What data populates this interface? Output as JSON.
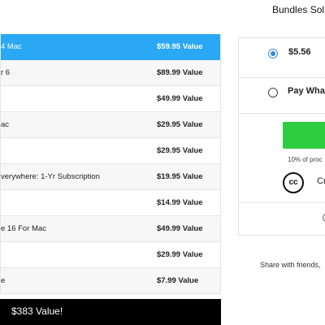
{
  "status_title": "Bundles Sol",
  "items": [
    {
      "name": "4 Mac",
      "value": "$59.95 Value",
      "highlighted": true
    },
    {
      "name": "r 6",
      "value": "$89.99 Value",
      "highlighted": false
    },
    {
      "name": "",
      "value": "$49.99 Value",
      "highlighted": false
    },
    {
      "name": "ac",
      "value": "$29.95 Value",
      "highlighted": false
    },
    {
      "name": "",
      "value": "$29.95 Value",
      "highlighted": false
    },
    {
      "name": "verywhere: 1-Yr Subscription",
      "value": "$19.95 Value",
      "highlighted": false
    },
    {
      "name": "",
      "value": "$14.99 Value",
      "highlighted": false
    },
    {
      "name": "e 16 For Mac",
      "value": "$49.99 Value",
      "highlighted": false
    },
    {
      "name": "",
      "value": "$29.99 Value",
      "highlighted": false
    },
    {
      "name": "e",
      "value": "$7.99 Value",
      "highlighted": false
    }
  ],
  "total_label": "$383 Value!",
  "price_options": {
    "fixed": {
      "label": "$5.56",
      "selected": true
    },
    "pwyw": {
      "label": "Pay Wha",
      "selected": false
    }
  },
  "charity_note": "10% of proc",
  "charity": {
    "icon": "cc-icon",
    "icon_text": "cc",
    "name": "Cr"
  },
  "share_text": "Share with friends,",
  "colors": {
    "highlight": "#2aa8f3",
    "buy_button": "#2ecc40",
    "total_bar": "#000000",
    "radio_selected": "#2f8be5"
  }
}
